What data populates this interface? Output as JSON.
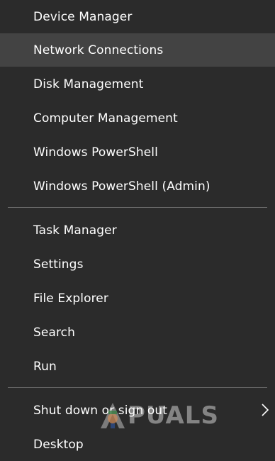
{
  "menu": {
    "items": [
      {
        "label": "Device Manager"
      },
      {
        "label": "Network Connections"
      },
      {
        "label": "Disk Management"
      },
      {
        "label": "Computer Management"
      },
      {
        "label": "Windows PowerShell"
      },
      {
        "label": "Windows PowerShell (Admin)"
      },
      {
        "label": "Task Manager"
      },
      {
        "label": "Settings"
      },
      {
        "label": "File Explorer"
      },
      {
        "label": "Search"
      },
      {
        "label": "Run"
      },
      {
        "label": "Shut down or sign out"
      },
      {
        "label": "Desktop"
      }
    ],
    "hovered_item": "Network Connections"
  },
  "colors": {
    "background": "#2b2b2b",
    "hover": "#434343",
    "separator": "#6a6a6a",
    "text": "#ffffff"
  },
  "icons": {
    "submenu": "chevron-right-icon"
  },
  "watermark": {
    "text": "PUALS"
  }
}
